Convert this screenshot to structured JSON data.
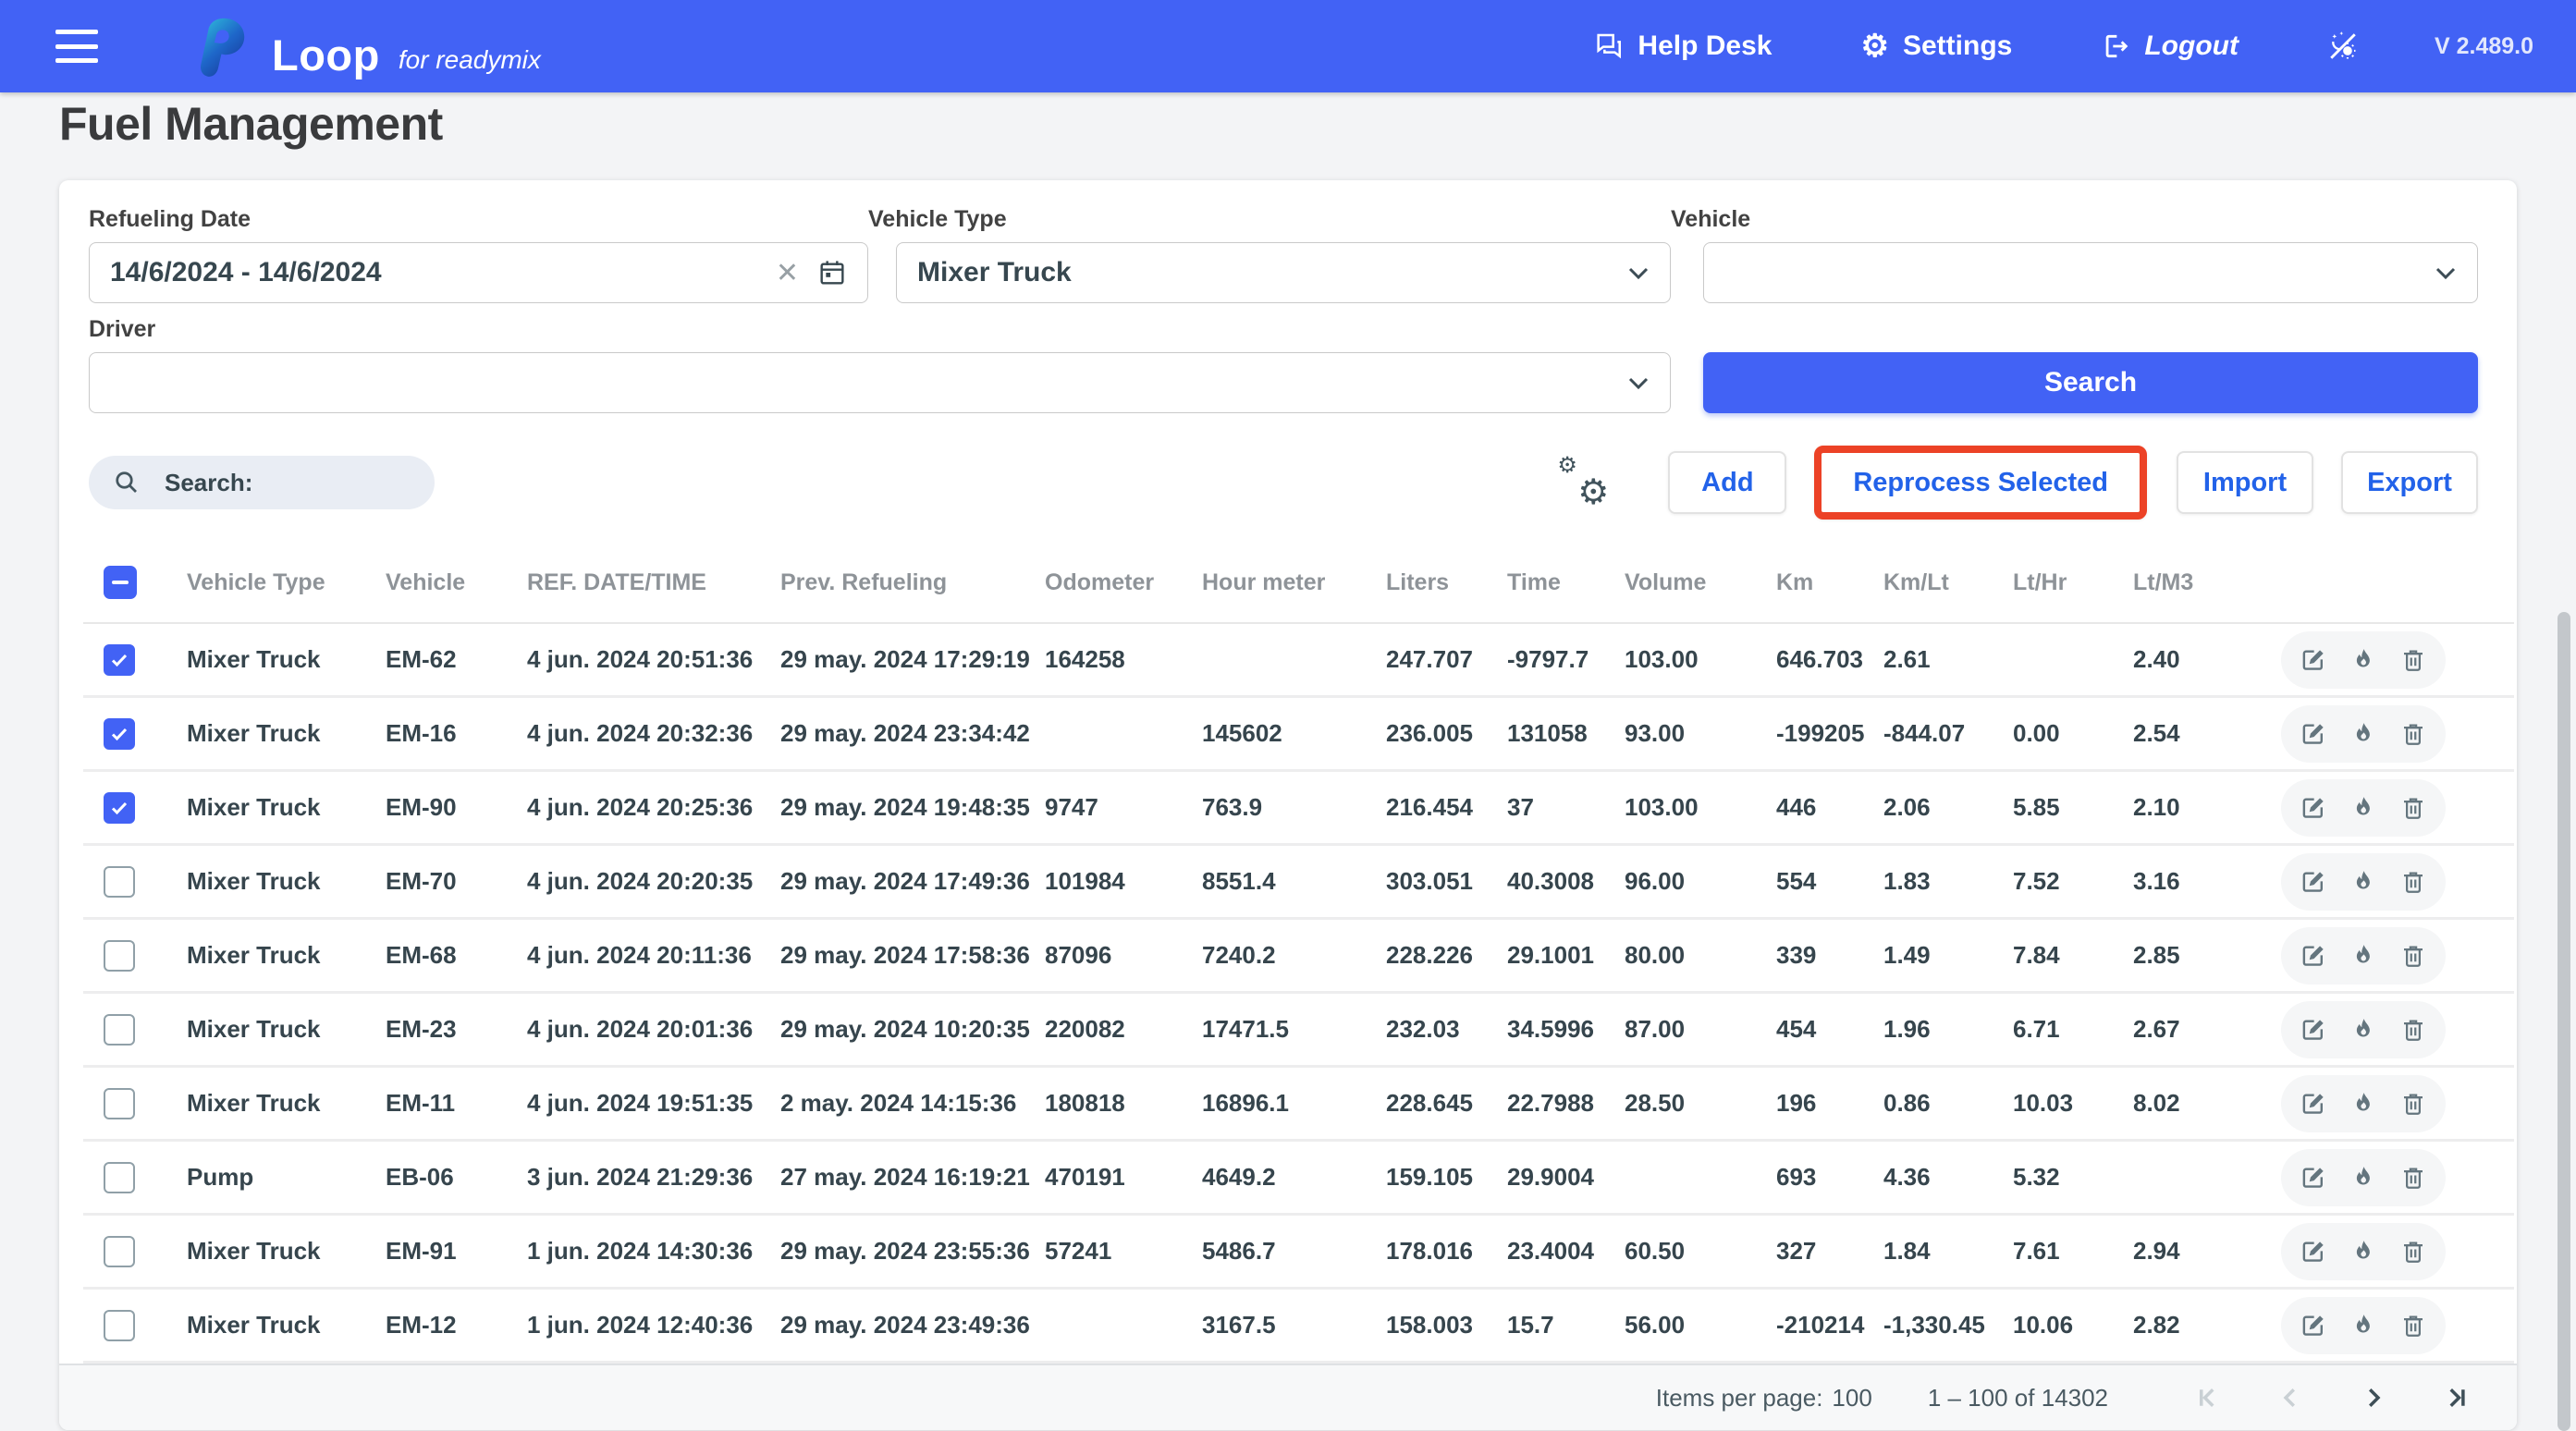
{
  "navbar": {
    "brand": "Loop",
    "brand_suffix": "for readymix",
    "help_desk": "Help Desk",
    "settings": "Settings",
    "logout": "Logout",
    "version": "V 2.489.0"
  },
  "page_title": "Fuel Management",
  "icons": {
    "gear_glyph": "⚙",
    "clear_glyph": "✕"
  },
  "colors": {
    "navbar_blue": "#4262f5",
    "button_text_blue": "#2262e9",
    "highlight_red": "#ec4226",
    "checkbox_blue": "#4262f5"
  },
  "filters": {
    "refueling_date": {
      "label": "Refueling Date",
      "value": "14/6/2024 - 14/6/2024"
    },
    "vehicle_type": {
      "label": "Vehicle Type",
      "value": "Mixer Truck"
    },
    "vehicle": {
      "label": "Vehicle",
      "value": ""
    },
    "driver": {
      "label": "Driver",
      "value": ""
    },
    "search_button": "Search"
  },
  "toolbar": {
    "search_label": "Search:",
    "add": "Add",
    "reprocess": "Reprocess Selected",
    "import": "Import",
    "export": "Export"
  },
  "table": {
    "columns": [
      "Vehicle Type",
      "Vehicle",
      "REF. DATE/TIME",
      "Prev. Refueling",
      "Odometer",
      "Hour meter",
      "Liters",
      "Time",
      "Volume",
      "Km",
      "Km/Lt",
      "Lt/Hr",
      "Lt/M3"
    ],
    "row_keys": [
      "vehicle_type",
      "vehicle",
      "ref_datetime",
      "prev_refueling",
      "odometer",
      "hour_meter",
      "liters",
      "time",
      "volume",
      "km",
      "km_lt",
      "lt_hr",
      "lt_m3"
    ],
    "rows": [
      {
        "checked": true,
        "vehicle_type": "Mixer Truck",
        "vehicle": "EM-62",
        "ref_datetime": "4 jun. 2024 20:51:36",
        "prev_refueling": "29 may. 2024 17:29:19",
        "odometer": "164258",
        "hour_meter": "",
        "liters": "247.707",
        "time": "-9797.7",
        "volume": "103.00",
        "km": "646.703",
        "km_lt": "2.61",
        "lt_hr": "",
        "lt_m3": "2.40"
      },
      {
        "checked": true,
        "vehicle_type": "Mixer Truck",
        "vehicle": "EM-16",
        "ref_datetime": "4 jun. 2024 20:32:36",
        "prev_refueling": "29 may. 2024 23:34:42",
        "odometer": "",
        "hour_meter": "145602",
        "liters": "236.005",
        "time": "131058",
        "volume": "93.00",
        "km": "-199205",
        "km_lt": "-844.07",
        "lt_hr": "0.00",
        "lt_m3": "2.54"
      },
      {
        "checked": true,
        "vehicle_type": "Mixer Truck",
        "vehicle": "EM-90",
        "ref_datetime": "4 jun. 2024 20:25:36",
        "prev_refueling": "29 may. 2024 19:48:35",
        "odometer": "9747",
        "hour_meter": "763.9",
        "liters": "216.454",
        "time": "37",
        "volume": "103.00",
        "km": "446",
        "km_lt": "2.06",
        "lt_hr": "5.85",
        "lt_m3": "2.10"
      },
      {
        "checked": false,
        "vehicle_type": "Mixer Truck",
        "vehicle": "EM-70",
        "ref_datetime": "4 jun. 2024 20:20:35",
        "prev_refueling": "29 may. 2024 17:49:36",
        "odometer": "101984",
        "hour_meter": "8551.4",
        "liters": "303.051",
        "time": "40.3008",
        "volume": "96.00",
        "km": "554",
        "km_lt": "1.83",
        "lt_hr": "7.52",
        "lt_m3": "3.16"
      },
      {
        "checked": false,
        "vehicle_type": "Mixer Truck",
        "vehicle": "EM-68",
        "ref_datetime": "4 jun. 2024 20:11:36",
        "prev_refueling": "29 may. 2024 17:58:36",
        "odometer": "87096",
        "hour_meter": "7240.2",
        "liters": "228.226",
        "time": "29.1001",
        "volume": "80.00",
        "km": "339",
        "km_lt": "1.49",
        "lt_hr": "7.84",
        "lt_m3": "2.85"
      },
      {
        "checked": false,
        "vehicle_type": "Mixer Truck",
        "vehicle": "EM-23",
        "ref_datetime": "4 jun. 2024 20:01:36",
        "prev_refueling": "29 may. 2024 10:20:35",
        "odometer": "220082",
        "hour_meter": "17471.5",
        "liters": "232.03",
        "time": "34.5996",
        "volume": "87.00",
        "km": "454",
        "km_lt": "1.96",
        "lt_hr": "6.71",
        "lt_m3": "2.67"
      },
      {
        "checked": false,
        "vehicle_type": "Mixer Truck",
        "vehicle": "EM-11",
        "ref_datetime": "4 jun. 2024 19:51:35",
        "prev_refueling": "2 may. 2024 14:15:36",
        "odometer": "180818",
        "hour_meter": "16896.1",
        "liters": "228.645",
        "time": "22.7988",
        "volume": "28.50",
        "km": "196",
        "km_lt": "0.86",
        "lt_hr": "10.03",
        "lt_m3": "8.02"
      },
      {
        "checked": false,
        "vehicle_type": "Pump",
        "vehicle": "EB-06",
        "ref_datetime": "3 jun. 2024 21:29:36",
        "prev_refueling": "27 may. 2024 16:19:21",
        "odometer": "470191",
        "hour_meter": "4649.2",
        "liters": "159.105",
        "time": "29.9004",
        "volume": "",
        "km": "693",
        "km_lt": "4.36",
        "lt_hr": "5.32",
        "lt_m3": ""
      },
      {
        "checked": false,
        "vehicle_type": "Mixer Truck",
        "vehicle": "EM-91",
        "ref_datetime": "1 jun. 2024 14:30:36",
        "prev_refueling": "29 may. 2024 23:55:36",
        "odometer": "57241",
        "hour_meter": "5486.7",
        "liters": "178.016",
        "time": "23.4004",
        "volume": "60.50",
        "km": "327",
        "km_lt": "1.84",
        "lt_hr": "7.61",
        "lt_m3": "2.94"
      },
      {
        "checked": false,
        "vehicle_type": "Mixer Truck",
        "vehicle": "EM-12",
        "ref_datetime": "1 jun. 2024 12:40:36",
        "prev_refueling": "29 may. 2024 23:49:36",
        "odometer": "",
        "hour_meter": "3167.5",
        "liters": "158.003",
        "time": "15.7",
        "volume": "56.00",
        "km": "-210214",
        "km_lt": "-1,330.45",
        "lt_hr": "10.06",
        "lt_m3": "2.82"
      }
    ]
  },
  "paginator": {
    "items_per_page_label": "Items per page:",
    "items_per_page": "100",
    "range": "1 – 100 of 14302"
  }
}
